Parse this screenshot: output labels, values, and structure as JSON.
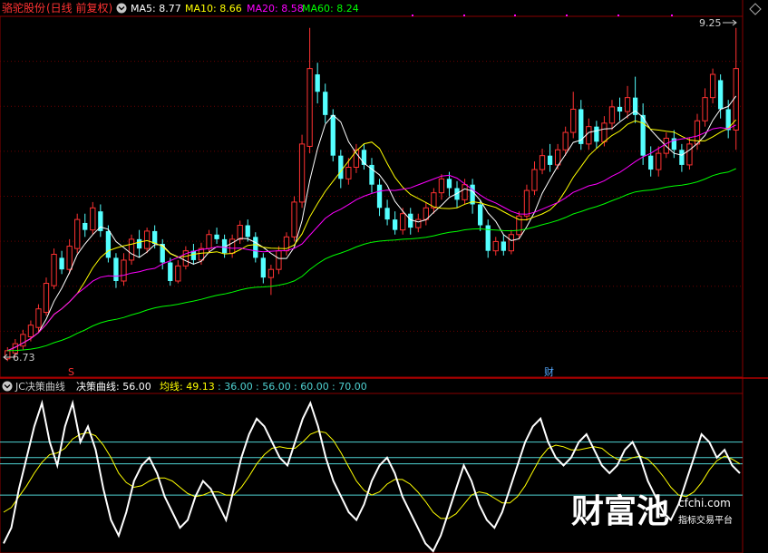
{
  "header": {
    "stock_name": "骆驼股份",
    "period": "(日线 前复权)",
    "ma5_label": "MA5: 8.77",
    "ma10_label": "MA10: 8.66",
    "ma20_label": "MA20: 8.58",
    "ma60_label": "MA60: 8.24"
  },
  "price_axis": {
    "max_label": "9.25",
    "min_label": "6.73"
  },
  "markers": {
    "sell_mark": "S",
    "finance_mark": "财"
  },
  "indicator_header": {
    "name": "JC决策曲线",
    "line1_label": "决策曲线: 56.00",
    "line2_label": "均线: 49.13",
    "level_1": ": 36.00",
    "level_2": ": 56.00",
    "level_3": ": 60.00",
    "level_4": ": 70.00"
  },
  "watermark": {
    "brand": "财富池",
    "url": "cfchi.com",
    "slogan": "指标交易平台"
  },
  "colors": {
    "up": "#ff3232",
    "down": "#54ffff",
    "ma5": "#ffffff",
    "ma10": "#ffff00",
    "ma20": "#ff00ff",
    "ma60": "#00ff00",
    "decision": "#ffffff",
    "decision_avg": "#ffff00",
    "level_line": "#4fd2d2"
  },
  "chart_data": [
    {
      "type": "candlestick",
      "title": "骆驼股份 (日线 前复权)",
      "ylim": [
        6.6,
        9.7
      ],
      "annotations": [
        "9.25",
        "6.73"
      ],
      "series": [
        {
          "name": "MA5",
          "last": 8.77
        },
        {
          "name": "MA10",
          "last": 8.66
        },
        {
          "name": "MA20",
          "last": 8.58
        },
        {
          "name": "MA60",
          "last": 8.24
        }
      ],
      "candles": [
        [
          6.75,
          6.82,
          6.73,
          6.85
        ],
        [
          6.8,
          6.88,
          6.76,
          6.92
        ],
        [
          6.86,
          6.96,
          6.83,
          7.0
        ],
        [
          6.94,
          7.04,
          6.9,
          7.08
        ],
        [
          7.02,
          7.18,
          6.98,
          7.22
        ],
        [
          7.15,
          7.4,
          7.12,
          7.45
        ],
        [
          7.38,
          7.65,
          7.35,
          7.7
        ],
        [
          7.62,
          7.52,
          7.48,
          7.68
        ],
        [
          7.52,
          7.72,
          7.48,
          7.78
        ],
        [
          7.7,
          7.95,
          7.66,
          8.0
        ],
        [
          7.92,
          7.86,
          7.8,
          8.0
        ],
        [
          7.86,
          8.05,
          7.82,
          8.1
        ],
        [
          8.02,
          7.85,
          7.8,
          8.08
        ],
        [
          7.85,
          7.62,
          7.58,
          7.9
        ],
        [
          7.62,
          7.42,
          7.36,
          7.66
        ],
        [
          7.42,
          7.6,
          7.38,
          7.66
        ],
        [
          7.6,
          7.78,
          7.56,
          7.82
        ],
        [
          7.78,
          7.7,
          7.62,
          7.86
        ],
        [
          7.7,
          7.85,
          7.66,
          7.88
        ],
        [
          7.85,
          7.74,
          7.7,
          7.9
        ],
        [
          7.74,
          7.58,
          7.52,
          7.78
        ],
        [
          7.58,
          7.42,
          7.38,
          7.62
        ],
        [
          7.42,
          7.55,
          7.4,
          7.6
        ],
        [
          7.55,
          7.68,
          7.52,
          7.72
        ],
        [
          7.68,
          7.6,
          7.56,
          7.74
        ],
        [
          7.6,
          7.7,
          7.56,
          7.75
        ],
        [
          7.7,
          7.82,
          7.66,
          7.86
        ],
        [
          7.82,
          7.78,
          7.74,
          7.88
        ],
        [
          7.78,
          7.66,
          7.62,
          7.82
        ],
        [
          7.66,
          7.78,
          7.62,
          7.82
        ],
        [
          7.78,
          7.9,
          7.74,
          7.94
        ],
        [
          7.9,
          7.8,
          7.76,
          7.95
        ],
        [
          7.8,
          7.62,
          7.58,
          7.84
        ],
        [
          7.62,
          7.45,
          7.4,
          7.66
        ],
        [
          7.45,
          7.52,
          7.3,
          7.56
        ],
        [
          7.52,
          7.68,
          7.48,
          7.72
        ],
        [
          7.68,
          7.8,
          7.64,
          7.84
        ],
        [
          7.8,
          8.1,
          7.76,
          8.15
        ],
        [
          8.1,
          8.6,
          8.05,
          8.68
        ],
        [
          8.58,
          9.25,
          8.52,
          9.6
        ],
        [
          9.2,
          9.05,
          8.95,
          9.3
        ],
        [
          9.05,
          8.85,
          8.78,
          9.12
        ],
        [
          8.85,
          8.5,
          8.45,
          8.9
        ],
        [
          8.5,
          8.3,
          8.22,
          8.55
        ],
        [
          8.3,
          8.4,
          8.25,
          8.48
        ],
        [
          8.4,
          8.55,
          8.35,
          8.6
        ],
        [
          8.55,
          8.42,
          8.38,
          8.6
        ],
        [
          8.42,
          8.25,
          8.18,
          8.48
        ],
        [
          8.25,
          8.05,
          7.98,
          8.3
        ],
        [
          8.05,
          7.95,
          7.9,
          8.12
        ],
        [
          7.95,
          7.86,
          7.82,
          8.02
        ],
        [
          7.86,
          8.0,
          7.82,
          8.05
        ],
        [
          8.0,
          7.88,
          7.82,
          8.05
        ],
        [
          7.88,
          7.95,
          7.84,
          8.0
        ],
        [
          7.95,
          8.05,
          7.9,
          8.1
        ],
        [
          8.05,
          8.18,
          8.0,
          8.22
        ],
        [
          8.18,
          8.3,
          8.12,
          8.34
        ],
        [
          8.3,
          8.22,
          8.15,
          8.36
        ],
        [
          8.22,
          8.12,
          8.05,
          8.28
        ],
        [
          8.12,
          8.25,
          8.08,
          8.3
        ],
        [
          8.25,
          8.08,
          8.0,
          8.3
        ],
        [
          8.08,
          7.9,
          7.85,
          8.12
        ],
        [
          7.9,
          7.68,
          7.62,
          7.95
        ],
        [
          7.68,
          7.76,
          7.64,
          7.8
        ],
        [
          7.76,
          7.68,
          7.64,
          7.82
        ],
        [
          7.68,
          7.82,
          7.65,
          7.86
        ],
        [
          7.82,
          7.98,
          7.78,
          8.02
        ],
        [
          7.98,
          8.2,
          7.94,
          8.25
        ],
        [
          8.2,
          8.38,
          8.16,
          8.45
        ],
        [
          8.38,
          8.5,
          8.34,
          8.56
        ],
        [
          8.5,
          8.42,
          8.36,
          8.6
        ],
        [
          8.42,
          8.55,
          8.38,
          8.6
        ],
        [
          8.55,
          8.7,
          8.5,
          8.75
        ],
        [
          8.7,
          8.9,
          8.65,
          9.05
        ],
        [
          8.9,
          8.6,
          8.55,
          8.98
        ],
        [
          8.6,
          8.75,
          8.55,
          8.82
        ],
        [
          8.75,
          8.62,
          8.56,
          8.8
        ],
        [
          8.62,
          8.78,
          8.58,
          8.84
        ],
        [
          8.78,
          8.92,
          8.72,
          8.98
        ],
        [
          8.92,
          8.88,
          8.8,
          9.0
        ],
        [
          8.88,
          9.0,
          8.82,
          9.1
        ],
        [
          9.0,
          8.85,
          8.78,
          9.18
        ],
        [
          8.85,
          8.5,
          8.42,
          8.95
        ],
        [
          8.5,
          8.38,
          8.32,
          8.58
        ],
        [
          8.38,
          8.52,
          8.32,
          8.58
        ],
        [
          8.52,
          8.65,
          8.48,
          8.7
        ],
        [
          8.65,
          8.55,
          8.48,
          8.72
        ],
        [
          8.55,
          8.42,
          8.36,
          8.6
        ],
        [
          8.42,
          8.6,
          8.38,
          8.66
        ],
        [
          8.6,
          8.8,
          8.55,
          8.86
        ],
        [
          8.8,
          9.0,
          8.75,
          9.08
        ],
        [
          9.0,
          9.2,
          8.95,
          9.25
        ],
        [
          9.15,
          8.9,
          8.82,
          9.2
        ],
        [
          8.9,
          8.72,
          8.65,
          8.98
        ],
        [
          8.72,
          9.25,
          8.55,
          9.6
        ]
      ]
    },
    {
      "type": "line",
      "title": "JC决策曲线",
      "ylim": [
        0,
        100
      ],
      "levels": [
        36,
        56,
        60,
        70
      ],
      "series": [
        {
          "name": "决策曲线",
          "last": 56.0,
          "values": [
            5,
            15,
            40,
            60,
            80,
            95,
            70,
            55,
            80,
            95,
            70,
            80,
            65,
            40,
            20,
            10,
            25,
            45,
            55,
            60,
            50,
            35,
            25,
            15,
            20,
            35,
            45,
            40,
            30,
            20,
            40,
            60,
            75,
            85,
            80,
            70,
            60,
            55,
            70,
            85,
            95,
            80,
            60,
            45,
            35,
            25,
            20,
            30,
            45,
            55,
            60,
            50,
            35,
            25,
            15,
            5,
            0,
            10,
            25,
            40,
            55,
            45,
            30,
            20,
            15,
            25,
            40,
            55,
            70,
            80,
            85,
            70,
            60,
            55,
            60,
            70,
            75,
            65,
            55,
            50,
            55,
            65,
            70,
            60,
            45,
            35,
            25,
            20,
            30,
            45,
            60,
            75,
            70,
            60,
            65,
            55,
            50
          ]
        },
        {
          "name": "均线",
          "last": 49.13,
          "values": [
            25,
            28,
            35,
            42,
            50,
            57,
            62,
            63,
            66,
            72,
            75,
            76,
            74,
            68,
            60,
            50,
            44,
            41,
            42,
            45,
            47,
            47,
            45,
            41,
            37,
            35,
            36,
            38,
            38,
            36,
            36,
            41,
            48,
            56,
            62,
            66,
            67,
            66,
            66,
            70,
            75,
            77,
            76,
            71,
            63,
            54,
            45,
            39,
            36,
            38,
            43,
            46,
            46,
            43,
            38,
            32,
            25,
            21,
            21,
            24,
            30,
            36,
            38,
            37,
            34,
            31,
            31,
            35,
            42,
            51,
            60,
            66,
            68,
            67,
            65,
            65,
            66,
            67,
            66,
            62,
            59,
            58,
            60,
            61,
            59,
            54,
            48,
            41,
            36,
            35,
            38,
            44,
            52,
            58,
            61,
            59,
            56
          ]
        }
      ]
    }
  ]
}
